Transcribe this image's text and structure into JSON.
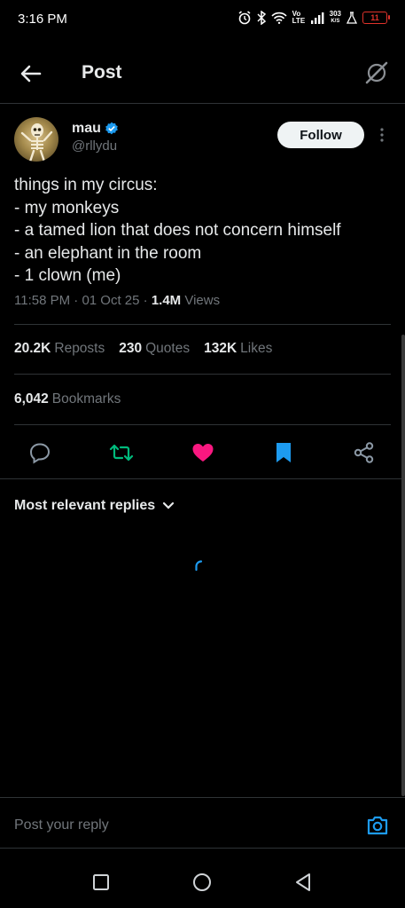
{
  "status_bar": {
    "time": "3:16 PM",
    "net_speed_value": "303",
    "net_speed_unit": "K/S",
    "battery": "11",
    "volte": "Vo LTE"
  },
  "header": {
    "title": "Post"
  },
  "author": {
    "name": "mau",
    "handle": "@rllydu",
    "verified": true
  },
  "follow_label": "Follow",
  "tweet": {
    "lines": [
      "things in my circus:",
      "- my monkeys",
      "- a tamed lion that does not concern himself",
      "- an elephant in the room",
      "- 1 clown (me)"
    ],
    "time": "11:58 PM",
    "date": "01 Oct 25",
    "views_count": "1.4M",
    "views_label": "Views"
  },
  "stats": {
    "reposts_count": "20.2K",
    "reposts_label": "Reposts",
    "quotes_count": "230",
    "quotes_label": "Quotes",
    "likes_count": "132K",
    "likes_label": "Likes",
    "bookmarks_count": "6,042",
    "bookmarks_label": "Bookmarks"
  },
  "colors": {
    "repost": "#00ba7c",
    "like": "#f91880",
    "bookmark": "#1d9bf0",
    "verified": "#1d9bf0"
  },
  "replies": {
    "sort_label": "Most relevant replies"
  },
  "reply_bar": {
    "placeholder": "Post your reply"
  }
}
